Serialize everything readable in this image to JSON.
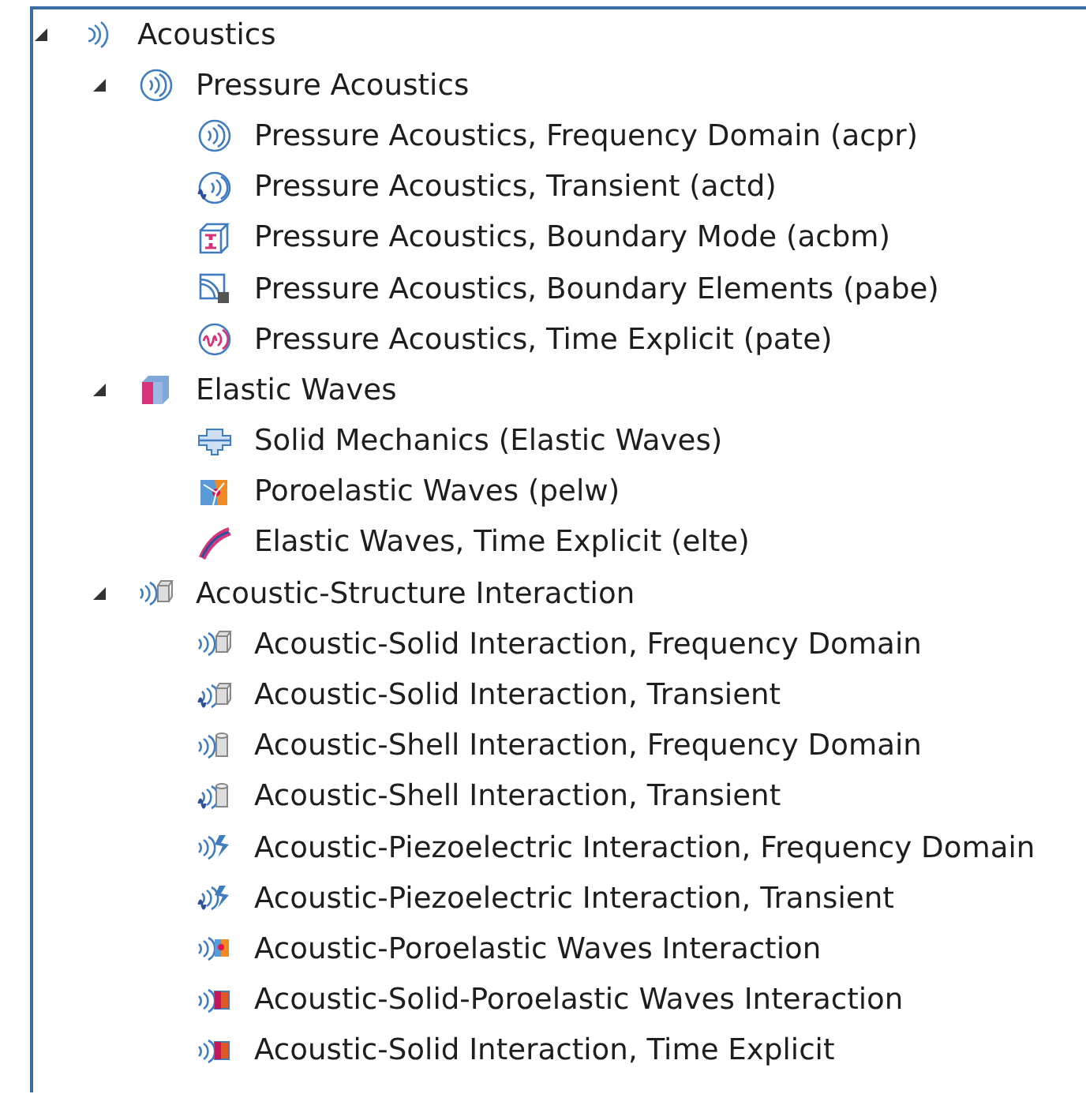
{
  "tree": [
    {
      "label": "Acoustics",
      "kind": "waves",
      "expanded": true,
      "children": [
        {
          "label": "Pressure Acoustics",
          "kind": "ring",
          "expanded": true,
          "children": [
            {
              "label": "Pressure Acoustics, Frequency Domain (acpr)",
              "kind": "ring"
            },
            {
              "label": "Pressure Acoustics, Transient (actd)",
              "kind": "ringwiggle"
            },
            {
              "label": "Pressure Acoustics, Boundary Mode (acbm)",
              "kind": "boundarymode"
            },
            {
              "label": "Pressure Acoustics, Boundary Elements (pabe)",
              "kind": "boundaryelem"
            },
            {
              "label": "Pressure Acoustics, Time Explicit (pate)",
              "kind": "pinkring"
            }
          ]
        },
        {
          "label": "Elastic Waves",
          "kind": "cube",
          "expanded": true,
          "children": [
            {
              "label": "Solid Mechanics (Elastic Waves)",
              "kind": "solid"
            },
            {
              "label": "Poroelastic Waves (pelw)",
              "kind": "poro"
            },
            {
              "label": "Elastic Waves, Time Explicit (elte)",
              "kind": "band"
            }
          ]
        },
        {
          "label": "Acoustic-Structure Interaction",
          "kind": "wavebox",
          "expanded": true,
          "children": [
            {
              "label": "Acoustic-Solid Interaction, Frequency Domain",
              "kind": "wavebox"
            },
            {
              "label": "Acoustic-Solid Interaction, Transient",
              "kind": "wigglebox"
            },
            {
              "label": "Acoustic-Shell Interaction, Frequency Domain",
              "kind": "wavecyl"
            },
            {
              "label": "Acoustic-Shell Interaction, Transient",
              "kind": "wigglecyl"
            },
            {
              "label": "Acoustic-Piezoelectric Interaction, Frequency Domain",
              "kind": "wavebolt"
            },
            {
              "label": "Acoustic-Piezoelectric Interaction, Transient",
              "kind": "wigglebolt"
            },
            {
              "label": "Acoustic-Poroelastic Waves Interaction",
              "kind": "waveporo"
            },
            {
              "label": "Acoustic-Solid-Poroelastic Waves Interaction",
              "kind": "wavecube"
            },
            {
              "label": "Acoustic-Solid Interaction, Time Explicit",
              "kind": "wavecube"
            }
          ]
        }
      ]
    }
  ]
}
